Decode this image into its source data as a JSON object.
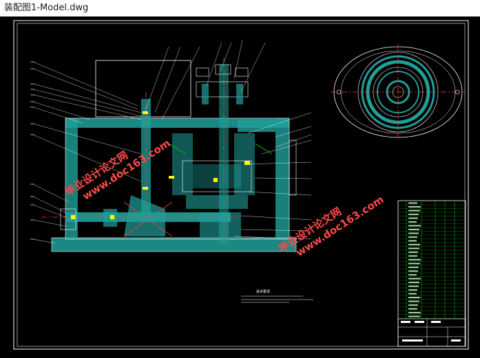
{
  "window": {
    "title": "装配图1-Model.dwg"
  },
  "drawing": {
    "background": "#000000",
    "line_colors": {
      "frame": "#ffffff",
      "section": "#1fa09a",
      "centerline": "#ff3b3b",
      "yellow": "#ffff00",
      "green": "#00c000"
    },
    "tech_requirements_title": "技术要求",
    "watermarks": [
      {
        "line1": "毕业设计论文网",
        "line2": "www.doc163.com"
      },
      {
        "line1": "毕业设计论文网",
        "line2": "www.doc163.com"
      }
    ]
  }
}
